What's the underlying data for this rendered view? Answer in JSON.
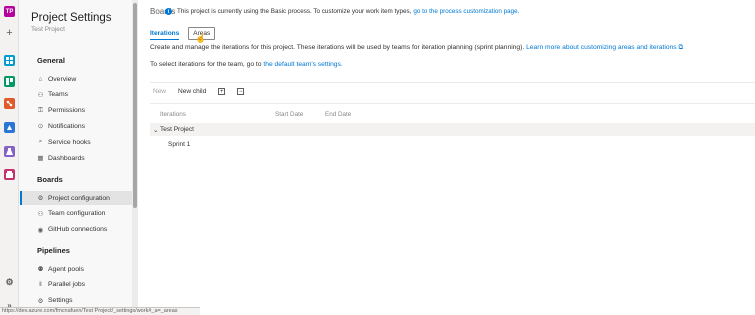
{
  "rail": {
    "org_badge": "TP",
    "items": [
      {
        "icon": "org-badge-icon",
        "color": "#b4009e"
      },
      {
        "icon": "plus-icon"
      },
      {
        "icon": "overview-icon",
        "color": "#009ccc"
      },
      {
        "icon": "boards-icon",
        "color": "#009966"
      },
      {
        "icon": "repos-icon",
        "color": "#e05a2b"
      },
      {
        "icon": "pipelines-icon",
        "color": "#2b76d4"
      },
      {
        "icon": "test-plans-icon",
        "color": "#8661c5"
      },
      {
        "icon": "artifacts-icon",
        "color": "#c33171"
      },
      {
        "icon": "gear-icon"
      },
      {
        "icon": "collapse-icon"
      }
    ]
  },
  "sidebar": {
    "title": "Project Settings",
    "subtitle": "Test Project",
    "groups": [
      {
        "label": "General",
        "items": [
          {
            "label": "Overview",
            "icon": "overview-icon",
            "glyph": "⌂"
          },
          {
            "label": "Teams",
            "icon": "teams-icon",
            "glyph": "⚇"
          },
          {
            "label": "Permissions",
            "icon": "permissions-icon",
            "glyph": "⚿"
          },
          {
            "label": "Notifications",
            "icon": "notifications-icon",
            "glyph": "⊙"
          },
          {
            "label": "Service hooks",
            "icon": "service-hooks-icon",
            "glyph": "⌕"
          },
          {
            "label": "Dashboards",
            "icon": "dashboards-icon",
            "glyph": "▦"
          }
        ]
      },
      {
        "label": "Boards",
        "items": [
          {
            "label": "Project configuration",
            "icon": "project-configuration-icon",
            "glyph": "⚙",
            "selected": true
          },
          {
            "label": "Team configuration",
            "icon": "team-configuration-icon",
            "glyph": "⚇"
          },
          {
            "label": "GitHub connections",
            "icon": "github-icon",
            "glyph": "◉"
          }
        ]
      },
      {
        "label": "Pipelines",
        "items": [
          {
            "label": "Agent pools",
            "icon": "agent-pools-icon",
            "glyph": "⚉"
          },
          {
            "label": "Parallel jobs",
            "icon": "parallel-jobs-icon",
            "glyph": "‖"
          },
          {
            "label": "Settings",
            "icon": "settings-icon",
            "glyph": "⚙"
          }
        ]
      }
    ]
  },
  "main": {
    "breadcrumb": "Boards",
    "banner_text": "This project is currently using the Basic process. To customize your work item types,",
    "banner_link": "go to the process customization page.",
    "tabs": [
      {
        "label": "Iterations",
        "active": true
      },
      {
        "label": "Areas",
        "active": false
      }
    ],
    "description": "Create and manage the iterations for this project. These iterations will be used by teams for iteration planning (sprint planning).",
    "description_link": "Learn more about customizing areas and iterations ⧉",
    "team_text": "To select iterations for the team, go to",
    "team_link": "the default team's settings.",
    "toolbar": {
      "new_label": "New",
      "new_child_label": "New child",
      "expand_glyph": "+",
      "collapse_glyph": "−"
    },
    "grid": {
      "columns": [
        "Iterations",
        "Start Date",
        "End Date"
      ],
      "rows": [
        {
          "name": "Test Project",
          "chevron": "⌄",
          "start": "",
          "end": ""
        },
        {
          "name": "Sprint 1",
          "start": "",
          "end": ""
        }
      ]
    }
  },
  "statusbar": {
    "url": "https://dev.azure.com/fmcnafuen/Test Project/_settings/work#_a=_areas"
  }
}
